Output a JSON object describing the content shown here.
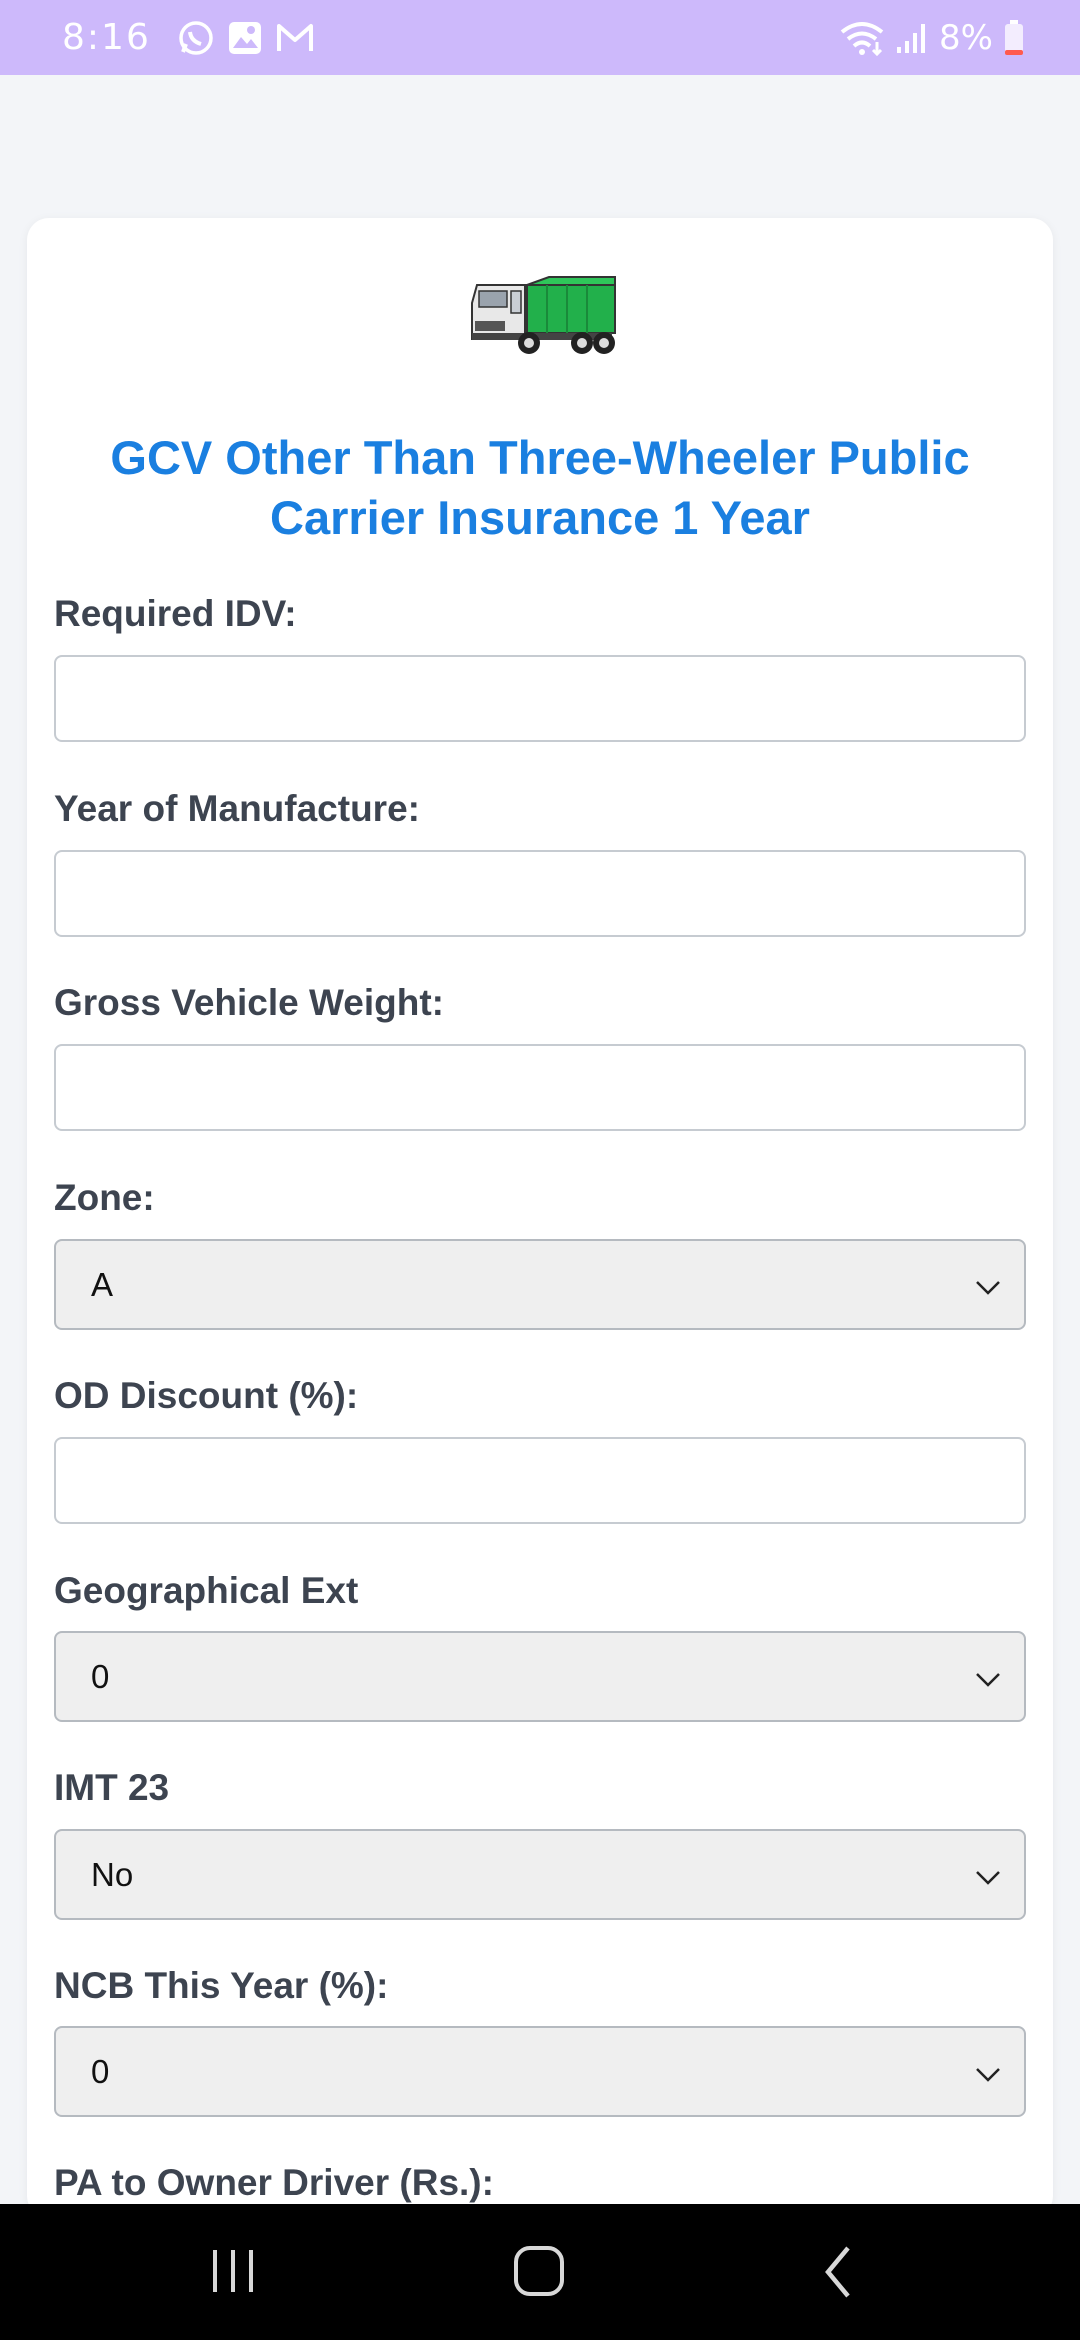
{
  "status": {
    "time": "8:16",
    "battery": "8%",
    "left_icons": [
      "whatsapp-icon",
      "gallery-icon",
      "gmail-icon"
    ],
    "right_icons": [
      "wifi-icon",
      "signal-icon",
      "battery-icon"
    ]
  },
  "page": {
    "title": "GCV Other Than Three-Wheeler Public Carrier Insurance 1 Year",
    "logo": "truck-logo"
  },
  "form": {
    "required_idv": {
      "label": "Required IDV:",
      "value": ""
    },
    "year_of_manufacture": {
      "label": "Year of Manufacture:",
      "value": ""
    },
    "gross_vehicle_weight": {
      "label": "Gross Vehicle Weight:",
      "value": ""
    },
    "zone": {
      "label": "Zone:",
      "value": "A"
    },
    "od_discount": {
      "label": "OD Discount (%):",
      "value": ""
    },
    "geographical_ext": {
      "label": "Geographical Ext",
      "value": "0"
    },
    "imt23": {
      "label": "IMT 23",
      "value": "No"
    },
    "ncb_this_year": {
      "label": "NCB This Year (%):",
      "value": "0"
    },
    "pa_owner_driver": {
      "label": "PA to Owner Driver (Rs.):"
    }
  },
  "colors": {
    "status_bar": "#cdb9fb",
    "title": "#1a7fe0",
    "label": "#3d4450",
    "truck_body": "#22b04b"
  },
  "nav": {
    "icons": [
      "recent-apps-icon",
      "home-icon",
      "back-icon"
    ]
  }
}
